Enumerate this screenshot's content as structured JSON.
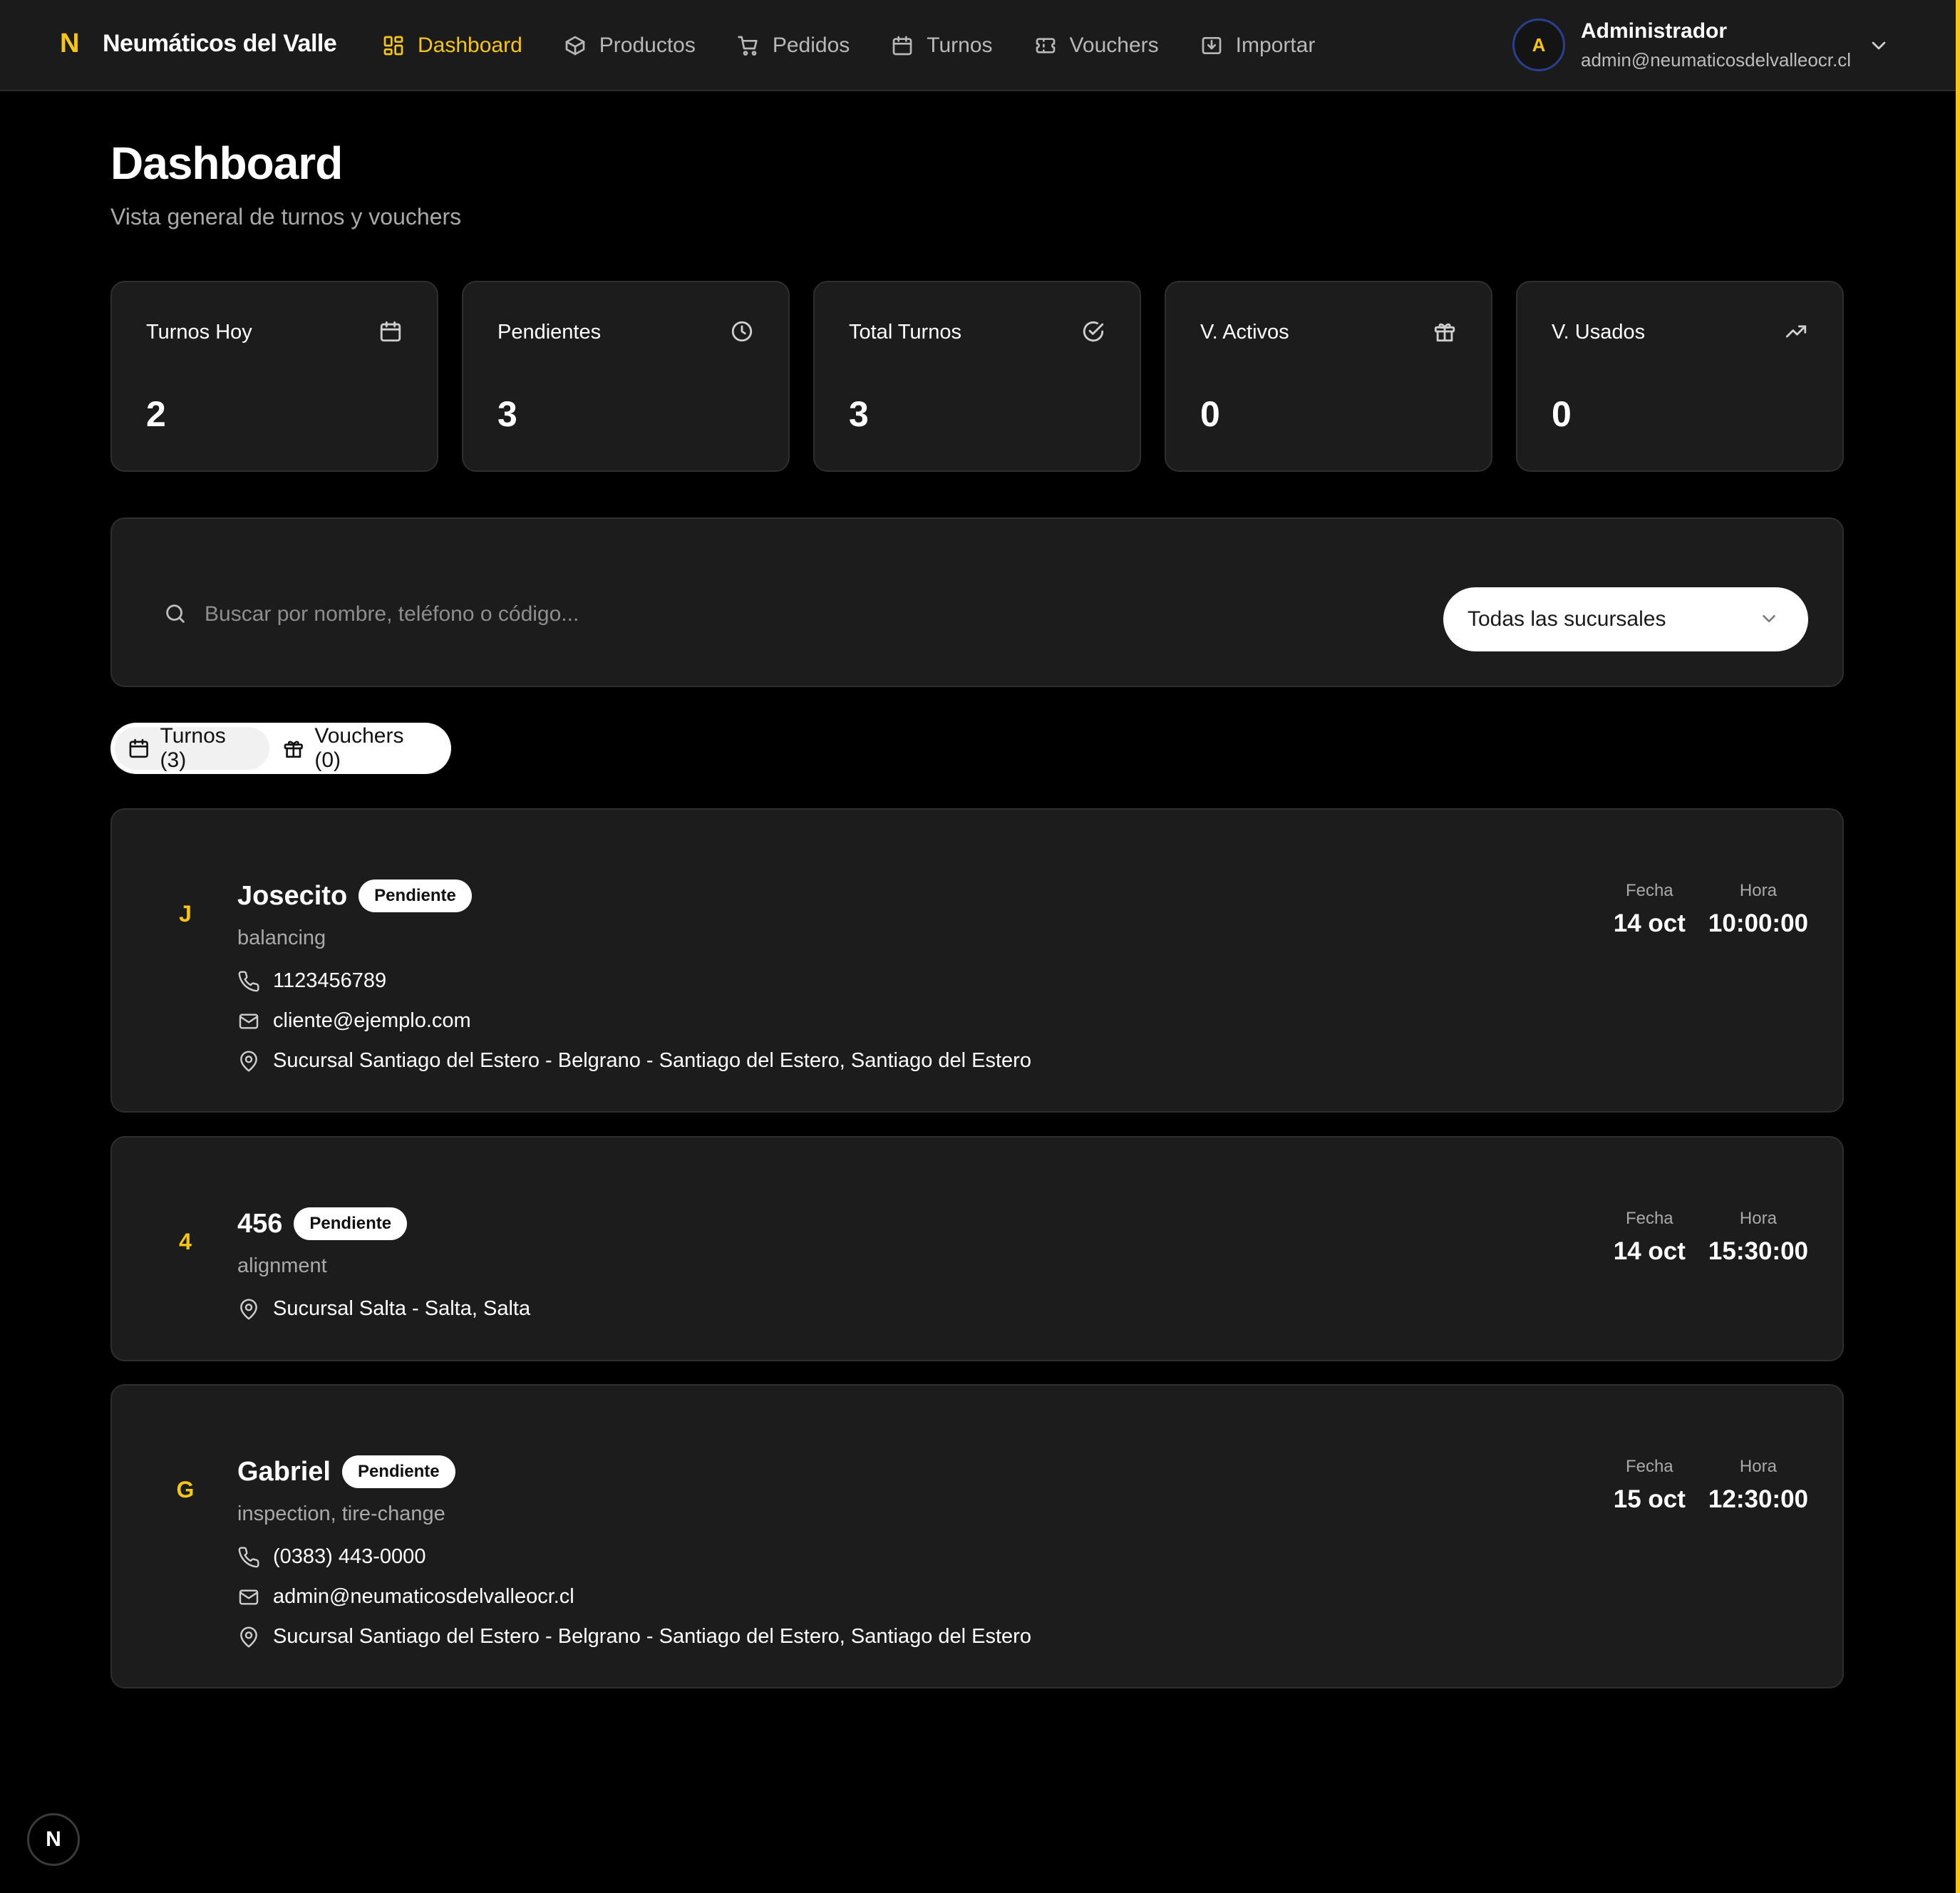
{
  "header": {
    "logo_letter": "N",
    "brand": "Neumáticos del Valle",
    "nav": [
      {
        "label": "Dashboard",
        "icon": "dashboard-grid-icon",
        "active": true
      },
      {
        "label": "Productos",
        "icon": "box-icon"
      },
      {
        "label": "Pedidos",
        "icon": "cart-icon"
      },
      {
        "label": "Turnos",
        "icon": "calendar-icon"
      },
      {
        "label": "Vouchers",
        "icon": "ticket-icon"
      },
      {
        "label": "Importar",
        "icon": "import-icon"
      }
    ],
    "user": {
      "initial": "A",
      "name": "Administrador",
      "email": "admin@neumaticosdelvalleocr.cl"
    }
  },
  "page": {
    "title": "Dashboard",
    "subtitle": "Vista general de turnos y vouchers"
  },
  "stats": [
    {
      "label": "Turnos Hoy",
      "value": "2",
      "icon": "calendar-icon"
    },
    {
      "label": "Pendientes",
      "value": "3",
      "icon": "clock-icon"
    },
    {
      "label": "Total Turnos",
      "value": "3",
      "icon": "check-circle-icon"
    },
    {
      "label": "V. Activos",
      "value": "0",
      "icon": "gift-icon"
    },
    {
      "label": "V. Usados",
      "value": "0",
      "icon": "trending-up-icon"
    }
  ],
  "filters": {
    "search_placeholder": "Buscar por nombre, teléfono o código...",
    "branch_selected": "Todas las sucursales"
  },
  "tabs": [
    {
      "label": "Turnos (3)",
      "icon": "calendar-icon",
      "active": true
    },
    {
      "label": "Vouchers (0)",
      "icon": "gift-icon"
    }
  ],
  "appointments": [
    {
      "initial": "J",
      "name": "Josecito",
      "status": "Pendiente",
      "service": "balancing",
      "phone": "1123456789",
      "email": "cliente@ejemplo.com",
      "location": "Sucursal Santiago del Estero - Belgrano - Santiago del Estero, Santiago del Estero",
      "fecha_label": "Fecha",
      "fecha": "14 oct",
      "hora_label": "Hora",
      "hora": "10:00:00"
    },
    {
      "initial": "4",
      "name": "456",
      "status": "Pendiente",
      "service": "alignment",
      "location": "Sucursal Salta - Salta, Salta",
      "fecha_label": "Fecha",
      "fecha": "14 oct",
      "hora_label": "Hora",
      "hora": "15:30:00"
    },
    {
      "initial": "G",
      "name": "Gabriel",
      "status": "Pendiente",
      "service": "inspection, tire-change",
      "phone": "(0383) 443-0000",
      "email": "admin@neumaticosdelvalleocr.cl",
      "location": "Sucursal Santiago del Estero - Belgrano - Santiago del Estero, Santiago del Estero",
      "fecha_label": "Fecha",
      "fecha": "15 oct",
      "hora_label": "Hora",
      "hora": "12:30:00"
    }
  ],
  "dev_badge": "N",
  "colors": {
    "accent": "#f5c518",
    "background": "#000000",
    "card": "#1c1c1c",
    "topbar": "#1b1b1b"
  }
}
